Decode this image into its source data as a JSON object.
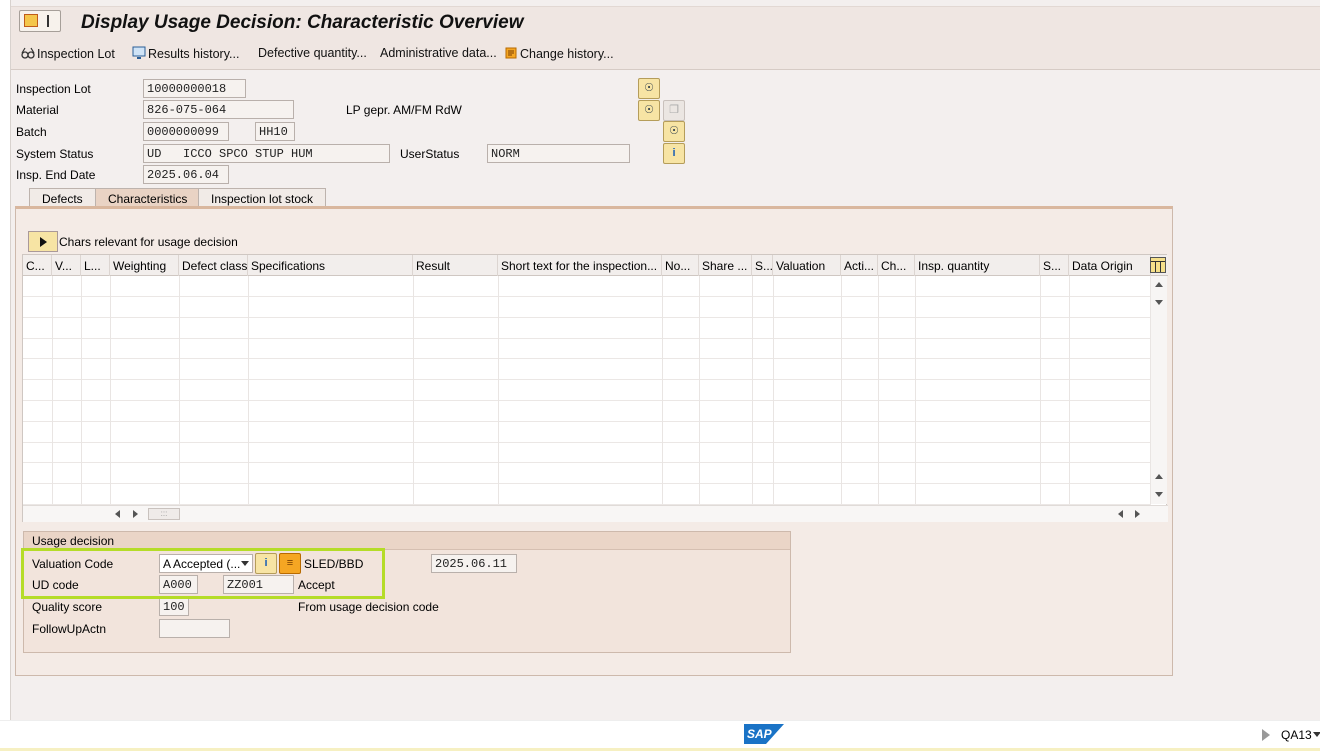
{
  "window": {
    "title": "Display Usage Decision: Characteristic Overview"
  },
  "toolbar": {
    "inspection_lot": "Inspection Lot",
    "results_history": "Results history...",
    "defective_quantity": "Defective quantity...",
    "administrative_data": "Administrative data...",
    "change_history": "Change history..."
  },
  "header": {
    "inspection_lot_label": "Inspection Lot",
    "inspection_lot_value": "10000000018",
    "material_label": "Material",
    "material_value": "826-075-064",
    "material_desc": "LP gepr. AM/FM RdW",
    "batch_label": "Batch",
    "batch_value": "0000000099",
    "batch_plant": "HH10",
    "system_status_label": "System Status",
    "system_status_value": "UD   ICCO SPCO STUP HUM",
    "user_status_label": "UserStatus",
    "user_status_value": "NORM",
    "insp_end_date_label": "Insp. End Date",
    "insp_end_date_value": "2025.06.04"
  },
  "tabs": [
    "Defects",
    "Characteristics",
    "Inspection lot stock"
  ],
  "characteristics": {
    "section_label": "Chars relevant for usage decision",
    "columns": [
      "C...",
      "V...",
      "L...",
      "Weighting",
      "Defect class",
      "Specifications",
      "Result",
      "Short text for the inspection...",
      "No...",
      "Share ...",
      "S...",
      "Valuation",
      "Acti...",
      "Ch...",
      "Insp. quantity",
      "S...",
      "Data Origin"
    ],
    "scroll_mid": ":::"
  },
  "usage_decision": {
    "title": "Usage decision",
    "valuation_code_label": "Valuation Code",
    "valuation_code_value": "A Accepted (...",
    "sled_label": "SLED/BBD",
    "sled_value": "2025.06.11",
    "ud_code_label": "UD code",
    "ud_code_value": "A000",
    "ud_code_group": "ZZ001",
    "ud_code_text": "Accept",
    "quality_score_label": "Quality score",
    "quality_score_value": "100",
    "quality_score_source": "From usage decision code",
    "followup_label": "FollowUpActn",
    "followup_value": ""
  },
  "status_bar": {
    "logo": "SAP",
    "transaction": "QA13"
  },
  "colors": {
    "highlight": "#b5dc28",
    "tab_active": "#e9d3c4",
    "background": "#f3efee"
  }
}
